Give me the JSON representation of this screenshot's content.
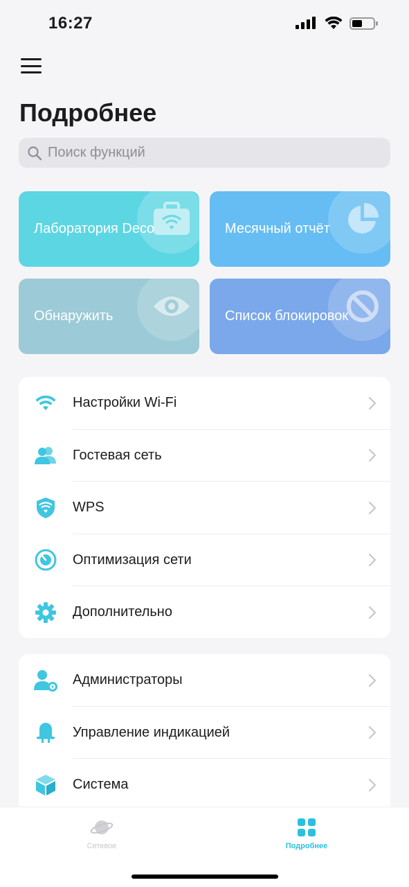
{
  "status_bar": {
    "time": "16:27"
  },
  "header": {
    "title": "Подробнее"
  },
  "search": {
    "placeholder": "Поиск функций"
  },
  "tiles": [
    {
      "label": "Лаборатория Deco",
      "color": "#5dd6e3",
      "icon": "briefcase-wifi-icon"
    },
    {
      "label": "Месячный отчёт",
      "color": "#66bdf3",
      "icon": "pie-chart-icon"
    },
    {
      "label": "Обнаружить",
      "color": "#9ccad6",
      "icon": "eye-icon"
    },
    {
      "label": "Список блокировок",
      "color": "#7aa8ea",
      "icon": "block-icon"
    }
  ],
  "network_section": {
    "items": [
      {
        "label": "Настройки Wi-Fi",
        "icon": "wifi-icon"
      },
      {
        "label": "Гостевая сеть",
        "icon": "users-icon"
      },
      {
        "label": "WPS",
        "icon": "shield-wifi-icon"
      },
      {
        "label": "Оптимизация сети",
        "icon": "gauge-icon"
      },
      {
        "label": "Дополнительно",
        "icon": "gear-icon"
      }
    ]
  },
  "system_section": {
    "items": [
      {
        "label": "Администраторы",
        "icon": "admin-user-icon"
      },
      {
        "label": "Управление индикацией",
        "icon": "led-light-icon"
      },
      {
        "label": "Система",
        "icon": "cube-icon"
      }
    ]
  },
  "tab_bar": {
    "tabs": [
      {
        "label": "Сетевое",
        "icon": "planet-icon",
        "active": false
      },
      {
        "label": "Подробнее",
        "icon": "grid-icon",
        "active": true
      }
    ]
  },
  "colors": {
    "accent": "#3fc6e0",
    "active_tab": "#2bbfe0",
    "inactive_tab": "#c7c7cc"
  }
}
